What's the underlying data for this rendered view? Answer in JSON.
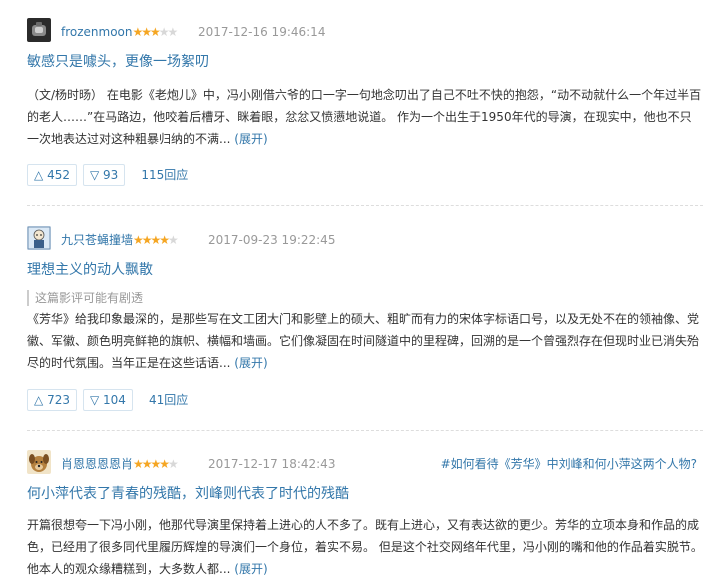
{
  "reviews": [
    {
      "author": "frozenmoon",
      "stars_on": "★★★",
      "stars_off": "★★",
      "time": "2017-12-16 19:46:14",
      "title": "敏感只是噱头，更像一场絮叨",
      "body": "（文/杨时旸） 在电影《老炮儿》中，冯小刚借六爷的口一字一句地念叨出了自己不吐不快的抱怨，“动不动就什么一个年过半百的老人……”在马路边，他咬着后槽牙、眯着眼，忿忿又愤懑地说道。 作为一个出生于1950年代的导演，在现实中，他也不只一次地表达过对这种粗暴归纳的不满... ",
      "expand": "(展开)",
      "up": "452",
      "down": "93",
      "replies": "115回应"
    },
    {
      "author": "九只苍蝇撞墙",
      "stars_on": "★★★★",
      "stars_off": "★",
      "time": "2017-09-23 19:22:45",
      "title": "理想主义的动人飘散",
      "spoiler": "这篇影评可能有剧透",
      "body": "《芳华》给我印象最深的，是那些写在文工团大门和影壁上的硕大、粗旷而有力的宋体字标语口号，以及无处不在的领袖像、党徽、军徽、颜色明亮鲜艳的旗帜、横幅和墙画。它们像凝固在时间隧道中的里程碑，回溯的是一个曾强烈存在但现时业已消失殆尽的时代氛围。当年正是在这些话语... ",
      "expand": "(展开)",
      "up": "723",
      "down": "104",
      "replies": "41回应"
    },
    {
      "author": "肖恩恩恩恩肖",
      "stars_on": "★★★★",
      "stars_off": "★",
      "time": "2017-12-17 18:42:43",
      "topic": "#如何看待《芳华》中刘峰和何小萍这两个人物?",
      "title": "何小萍代表了青春的残酷，刘峰则代表了时代的残酷",
      "body": "开篇很想夸一下冯小刚，他那代导演里保持着上进心的人不多了。既有上进心，又有表达欲的更少。芳华的立项本身和作品的成色，已经用了很多同代里履历辉煌的导演们一个身位，着实不易。 但是这个社交网络年代里，冯小刚的嘴和他的作品着实脱节。他本人的观众缘糟糕到，大多数人都... ",
      "expand": "(展开)"
    }
  ],
  "icons": {
    "up": "△",
    "down": "▽"
  },
  "colors": {
    "link": "#3377aa",
    "star": "#f5a623",
    "meta": "#999999"
  }
}
